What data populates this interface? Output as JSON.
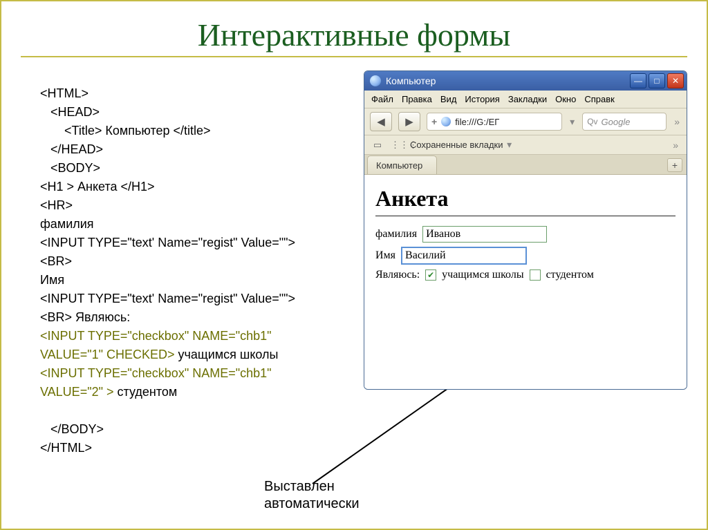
{
  "slide": {
    "title": "Интерактивные формы",
    "caption_line1": "Выставлен",
    "caption_line2": "автоматически"
  },
  "code": {
    "l1": "<HTML>",
    "l2": "   <HEAD>",
    "l3": "       <Title> Компьютер </title>",
    "l4": "   </HEAD>",
    "l5": "   <BODY>",
    "l6": "<H1 > Анкета </H1>",
    "l7": "<HR>",
    "l8": "фамилия",
    "l9": "<INPUT TYPE=\"text' Name=\"regist\" Value=\"\">",
    "l10": "<BR>",
    "l11": "Имя",
    "l12": "<INPUT TYPE=\"text' Name=\"regist\" Value=\"\">",
    "l13": "<BR> Являюсь:",
    "l14": "<INPUT TYPE=\"checkbox\" NAME=\"chb1\"",
    "l15": "VALUE=\"1\" CHECKED>",
    "l15b": " учащимся школы",
    "l16": "<INPUT TYPE=\"checkbox\" NAME=\"chb1\"",
    "l17": "VALUE=\"2\" > ",
    "l17b": "студентом",
    "l18": "   </BODY>",
    "l19": "</HTML>"
  },
  "browser": {
    "window_title": "Компьютер",
    "menu": [
      "Файл",
      "Правка",
      "Вид",
      "История",
      "Закладки",
      "Окно",
      "Справк"
    ],
    "url": "file:///G:/ЕГ",
    "search_placeholder": "Google",
    "bookmarks_label": "Сохраненные вкладки",
    "tab_label": "Компьютер"
  },
  "page": {
    "heading": "Анкета",
    "label_lastname": "фамилия",
    "value_lastname": "Иванов",
    "label_firstname": "Имя",
    "value_firstname": "Василий",
    "label_status": "Являюсь:",
    "opt_school": "учащимся школы",
    "opt_student": "студентом"
  }
}
